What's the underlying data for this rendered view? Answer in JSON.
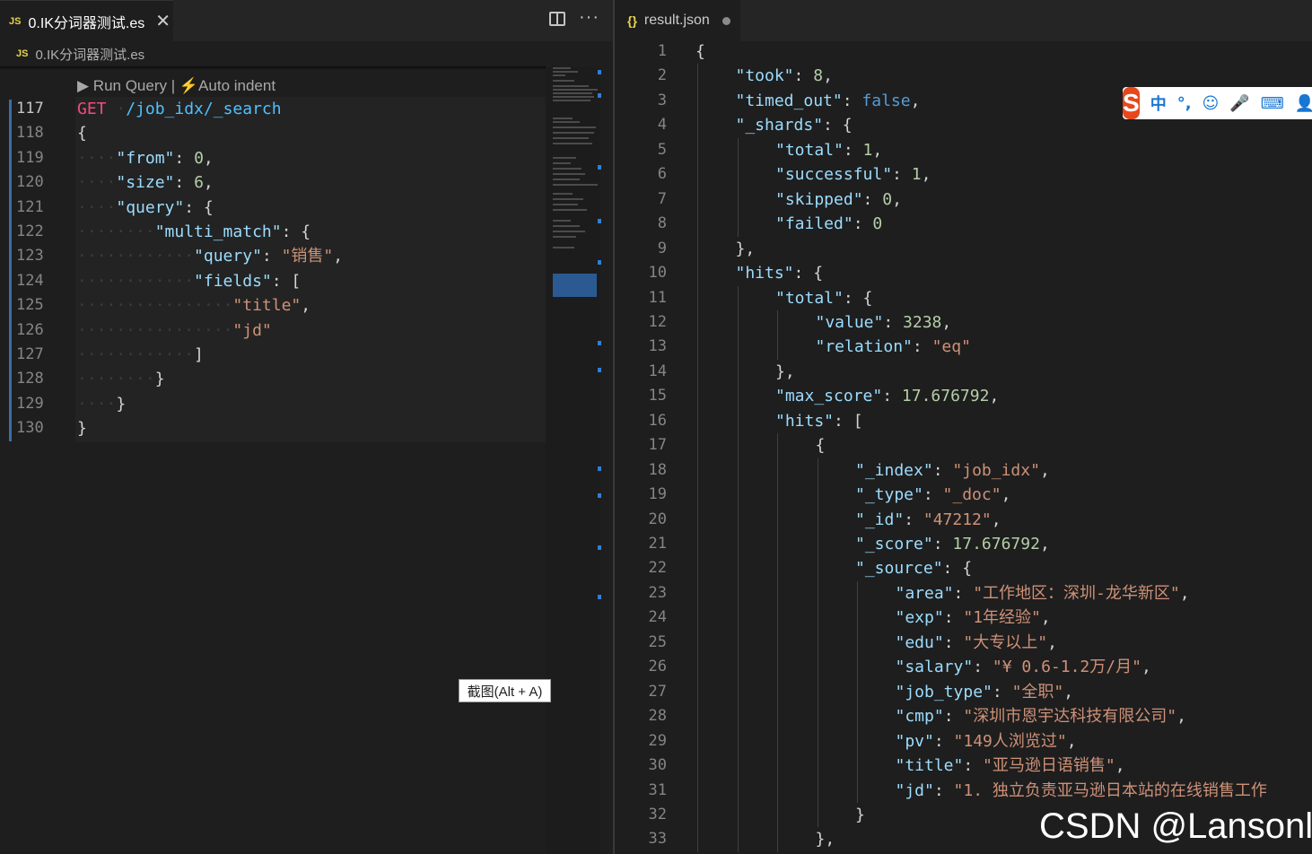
{
  "left_editor": {
    "tab_title": "0.IK分词器测试.es",
    "tab_lang_badge": "JS",
    "breadcrumb": "0.IK分词器测试.es",
    "codelens_run": "▶ Run Query |",
    "codelens_indent": "Auto indent",
    "lines": [
      {
        "n": "117",
        "tokens": [
          [
            "method",
            "GET"
          ],
          [
            "ws",
            " ·"
          ],
          [
            "path",
            "/job_idx/_search"
          ]
        ]
      },
      {
        "n": "118",
        "tokens": [
          [
            "",
            "{"
          ]
        ]
      },
      {
        "n": "119",
        "tokens": [
          [
            "ws",
            "····"
          ],
          [
            "key",
            "\"from\""
          ],
          [
            "",
            ": "
          ],
          [
            "num",
            "0"
          ],
          [
            "",
            ","
          ]
        ]
      },
      {
        "n": "120",
        "tokens": [
          [
            "ws",
            "····"
          ],
          [
            "key",
            "\"size\""
          ],
          [
            "",
            ": "
          ],
          [
            "num",
            "6"
          ],
          [
            "",
            ","
          ]
        ]
      },
      {
        "n": "121",
        "tokens": [
          [
            "ws",
            "····"
          ],
          [
            "key",
            "\"query\""
          ],
          [
            "",
            ": {"
          ]
        ]
      },
      {
        "n": "122",
        "tokens": [
          [
            "ws",
            "········"
          ],
          [
            "key",
            "\"multi_match\""
          ],
          [
            "",
            ": {"
          ]
        ]
      },
      {
        "n": "123",
        "tokens": [
          [
            "ws",
            "············"
          ],
          [
            "key",
            "\"query\""
          ],
          [
            "",
            ": "
          ],
          [
            "str",
            "\"销售\""
          ],
          [
            "",
            ","
          ]
        ]
      },
      {
        "n": "124",
        "tokens": [
          [
            "ws",
            "············"
          ],
          [
            "key",
            "\"fields\""
          ],
          [
            "",
            ": ["
          ]
        ]
      },
      {
        "n": "125",
        "tokens": [
          [
            "ws",
            "················"
          ],
          [
            "str",
            "\"title\""
          ],
          [
            "",
            ","
          ]
        ]
      },
      {
        "n": "126",
        "tokens": [
          [
            "ws",
            "················"
          ],
          [
            "str",
            "\"jd\""
          ]
        ]
      },
      {
        "n": "127",
        "tokens": [
          [
            "ws",
            "············"
          ],
          [
            "",
            "]"
          ]
        ]
      },
      {
        "n": "128",
        "tokens": [
          [
            "ws",
            "········"
          ],
          [
            "",
            "}"
          ]
        ]
      },
      {
        "n": "129",
        "tokens": [
          [
            "ws",
            "····"
          ],
          [
            "",
            "}"
          ]
        ]
      },
      {
        "n": "130",
        "tokens": [
          [
            "",
            "}"
          ]
        ]
      }
    ]
  },
  "tooltip": "截图(Alt + A)",
  "right_editor": {
    "tab_title": "result.json",
    "tab_icon": "{}",
    "lines": [
      {
        "n": "1",
        "indent": 0,
        "tokens": [
          [
            "",
            "{"
          ]
        ]
      },
      {
        "n": "2",
        "indent": 1,
        "tokens": [
          [
            "key",
            "\"took\""
          ],
          [
            "",
            ": "
          ],
          [
            "num",
            "8"
          ],
          [
            "",
            ","
          ]
        ]
      },
      {
        "n": "3",
        "indent": 1,
        "tokens": [
          [
            "key",
            "\"timed_out\""
          ],
          [
            "",
            ": "
          ],
          [
            "bool",
            "false"
          ],
          [
            "",
            ","
          ]
        ]
      },
      {
        "n": "4",
        "indent": 1,
        "tokens": [
          [
            "key",
            "\"_shards\""
          ],
          [
            "",
            ": {"
          ]
        ]
      },
      {
        "n": "5",
        "indent": 2,
        "tokens": [
          [
            "key",
            "\"total\""
          ],
          [
            "",
            ": "
          ],
          [
            "num",
            "1"
          ],
          [
            "",
            ","
          ]
        ]
      },
      {
        "n": "6",
        "indent": 2,
        "tokens": [
          [
            "key",
            "\"successful\""
          ],
          [
            "",
            ": "
          ],
          [
            "num",
            "1"
          ],
          [
            "",
            ","
          ]
        ]
      },
      {
        "n": "7",
        "indent": 2,
        "tokens": [
          [
            "key",
            "\"skipped\""
          ],
          [
            "",
            ": "
          ],
          [
            "num",
            "0"
          ],
          [
            "",
            ","
          ]
        ]
      },
      {
        "n": "8",
        "indent": 2,
        "tokens": [
          [
            "key",
            "\"failed\""
          ],
          [
            "",
            ": "
          ],
          [
            "num",
            "0"
          ]
        ]
      },
      {
        "n": "9",
        "indent": 1,
        "tokens": [
          [
            "",
            "},"
          ]
        ]
      },
      {
        "n": "10",
        "indent": 1,
        "tokens": [
          [
            "key",
            "\"hits\""
          ],
          [
            "",
            ": {"
          ]
        ]
      },
      {
        "n": "11",
        "indent": 2,
        "tokens": [
          [
            "key",
            "\"total\""
          ],
          [
            "",
            ": {"
          ]
        ]
      },
      {
        "n": "12",
        "indent": 3,
        "tokens": [
          [
            "key",
            "\"value\""
          ],
          [
            "",
            ": "
          ],
          [
            "num",
            "3238"
          ],
          [
            "",
            ","
          ]
        ]
      },
      {
        "n": "13",
        "indent": 3,
        "tokens": [
          [
            "key",
            "\"relation\""
          ],
          [
            "",
            ": "
          ],
          [
            "str",
            "\"eq\""
          ]
        ]
      },
      {
        "n": "14",
        "indent": 2,
        "tokens": [
          [
            "",
            "},"
          ]
        ]
      },
      {
        "n": "15",
        "indent": 2,
        "tokens": [
          [
            "key",
            "\"max_score\""
          ],
          [
            "",
            ": "
          ],
          [
            "num",
            "17.676792"
          ],
          [
            "",
            ","
          ]
        ]
      },
      {
        "n": "16",
        "indent": 2,
        "tokens": [
          [
            "key",
            "\"hits\""
          ],
          [
            "",
            ": ["
          ]
        ]
      },
      {
        "n": "17",
        "indent": 3,
        "tokens": [
          [
            "",
            "{"
          ]
        ]
      },
      {
        "n": "18",
        "indent": 4,
        "tokens": [
          [
            "key",
            "\"_index\""
          ],
          [
            "",
            ": "
          ],
          [
            "str",
            "\"job_idx\""
          ],
          [
            "",
            ","
          ]
        ]
      },
      {
        "n": "19",
        "indent": 4,
        "tokens": [
          [
            "key",
            "\"_type\""
          ],
          [
            "",
            ": "
          ],
          [
            "str",
            "\"_doc\""
          ],
          [
            "",
            ","
          ]
        ]
      },
      {
        "n": "20",
        "indent": 4,
        "tokens": [
          [
            "key",
            "\"_id\""
          ],
          [
            "",
            ": "
          ],
          [
            "str",
            "\"47212\""
          ],
          [
            "",
            ","
          ]
        ]
      },
      {
        "n": "21",
        "indent": 4,
        "tokens": [
          [
            "key",
            "\"_score\""
          ],
          [
            "",
            ": "
          ],
          [
            "num",
            "17.676792"
          ],
          [
            "",
            ","
          ]
        ]
      },
      {
        "n": "22",
        "indent": 4,
        "tokens": [
          [
            "key",
            "\"_source\""
          ],
          [
            "",
            ": {"
          ]
        ]
      },
      {
        "n": "23",
        "indent": 5,
        "tokens": [
          [
            "key",
            "\"area\""
          ],
          [
            "",
            ": "
          ],
          [
            "str",
            "\"工作地区：深圳-龙华新区\""
          ],
          [
            "",
            ","
          ]
        ]
      },
      {
        "n": "24",
        "indent": 5,
        "tokens": [
          [
            "key",
            "\"exp\""
          ],
          [
            "",
            ": "
          ],
          [
            "str",
            "\"1年经验\""
          ],
          [
            "",
            ","
          ]
        ]
      },
      {
        "n": "25",
        "indent": 5,
        "tokens": [
          [
            "key",
            "\"edu\""
          ],
          [
            "",
            ": "
          ],
          [
            "str",
            "\"大专以上\""
          ],
          [
            "",
            ","
          ]
        ]
      },
      {
        "n": "26",
        "indent": 5,
        "tokens": [
          [
            "key",
            "\"salary\""
          ],
          [
            "",
            ": "
          ],
          [
            "str",
            "\"¥ 0.6-1.2万/月\""
          ],
          [
            "",
            ","
          ]
        ]
      },
      {
        "n": "27",
        "indent": 5,
        "tokens": [
          [
            "key",
            "\"job_type\""
          ],
          [
            "",
            ": "
          ],
          [
            "str",
            "\"全职\""
          ],
          [
            "",
            ","
          ]
        ]
      },
      {
        "n": "28",
        "indent": 5,
        "tokens": [
          [
            "key",
            "\"cmp\""
          ],
          [
            "",
            ": "
          ],
          [
            "str",
            "\"深圳市恩宇达科技有限公司\""
          ],
          [
            "",
            ","
          ]
        ]
      },
      {
        "n": "29",
        "indent": 5,
        "tokens": [
          [
            "key",
            "\"pv\""
          ],
          [
            "",
            ": "
          ],
          [
            "str",
            "\"149人浏览过\""
          ],
          [
            "",
            ","
          ]
        ]
      },
      {
        "n": "30",
        "indent": 5,
        "tokens": [
          [
            "key",
            "\"title\""
          ],
          [
            "",
            ": "
          ],
          [
            "str",
            "\"亚马逊日语销售\""
          ],
          [
            "",
            ","
          ]
        ]
      },
      {
        "n": "31",
        "indent": 5,
        "tokens": [
          [
            "key",
            "\"jd\""
          ],
          [
            "",
            ": "
          ],
          [
            "str",
            "\"1. 独立负责亚马逊日本站的在线销售工作"
          ]
        ]
      },
      {
        "n": "32",
        "indent": 4,
        "tokens": [
          [
            "",
            "}"
          ]
        ]
      },
      {
        "n": "33",
        "indent": 3,
        "tokens": [
          [
            "",
            "},"
          ]
        ]
      }
    ]
  },
  "ime_toolbar": {
    "logo": "S",
    "items": [
      "中",
      "°,",
      "☺",
      "🎤",
      "⌨",
      "👤"
    ]
  },
  "watermark": "CSDN @Lansonli",
  "colors": {
    "editor_bg": "#1e1e1e",
    "key": "#9cdcfe",
    "string": "#ce9178",
    "number": "#b5cea8",
    "keyword_method": "#f14c7d",
    "path": "#4fc1ff",
    "boolean": "#569cd6",
    "ime_logo": "#e8471c"
  }
}
